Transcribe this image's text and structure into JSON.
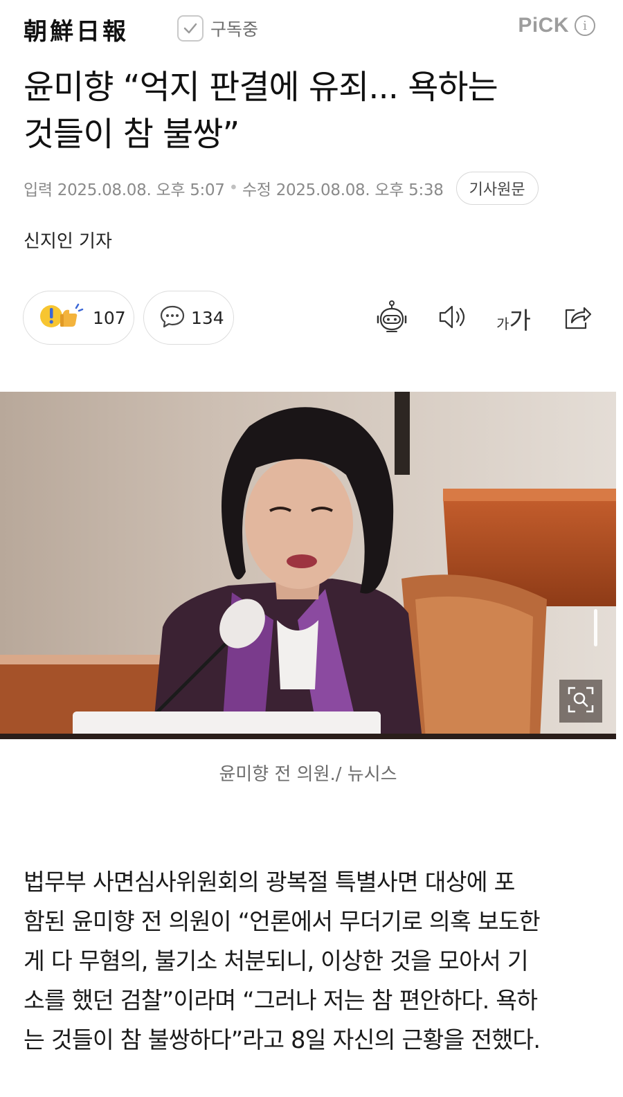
{
  "header": {
    "logo_text": "朝鮮日報",
    "subscribe_label": "구독중",
    "pick_label": "PiCK",
    "info_glyph": "i"
  },
  "article": {
    "headline_line1": "윤미향 “억지 판결에 유죄... 욕하는",
    "headline_line2": "것들이 참 불쌍”",
    "published_label": "입력",
    "published_time": "2025.08.08. 오후 5:07",
    "modified_label": "수정",
    "modified_time": "2025.08.08. 오후 5:38",
    "original_button": "기사원문",
    "byline": "신지인 기자",
    "photo_caption": "윤미향 전 의원./ 뉴시스",
    "body_lines": [
      "법무부 사면심사위원회의 광복절 특별사면 대상에 포",
      "함된 윤미향 전 의원이 “언론에서 무더기로 의혹 보도한",
      "게 다 무혐의, 불기소 처분되니, 이상한 것을 모아서 기",
      "소를 했던 검찰”이라며 “그러나 저는 참 편안하다. 욕하",
      "는 것들이 참 불쌍하다”라고 8일 자신의 근황을 전했다."
    ]
  },
  "actions": {
    "reaction_count": "107",
    "comment_count": "134",
    "font_small": "가",
    "font_big": "가"
  },
  "icons": {
    "reaction": "reaction-emoji-icon",
    "comment": "comment-bubble-icon",
    "summary_bot": "robot-icon",
    "audio": "speaker-icon",
    "font_size": "font-size-icon",
    "share": "share-icon",
    "zoom": "zoom-icon",
    "check": "check-icon"
  },
  "colors": {
    "meta_text": "#8a8a8a",
    "border": "#dcdcdc",
    "reaction_yellow": "#f7c531"
  }
}
